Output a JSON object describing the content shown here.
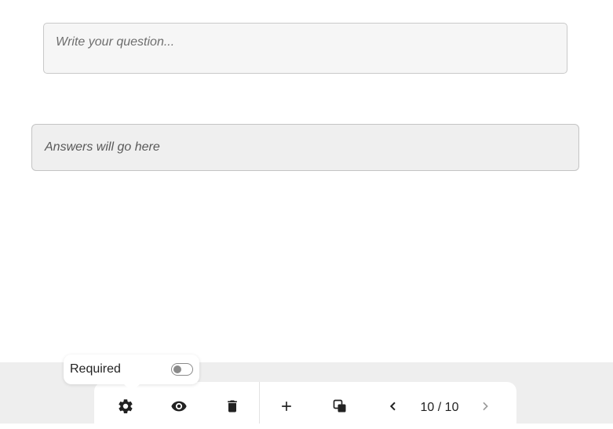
{
  "question": {
    "placeholder": "Write your question...",
    "value": ""
  },
  "answers": {
    "placeholder": "Answers will go here"
  },
  "required_popover": {
    "label": "Required",
    "enabled": false
  },
  "toolbar": {
    "icons": {
      "settings": "gear-icon",
      "preview": "eye-icon",
      "delete": "trash-icon",
      "add": "plus-icon",
      "duplicate": "duplicate-icon",
      "prev": "chevron-left-icon",
      "next": "chevron-right-icon"
    },
    "page_indicator": "10 / 10",
    "next_enabled": false
  },
  "colors": {
    "canvas": "#ffffff",
    "background": "#eeeeee",
    "input_fill": "#f6f6f6",
    "answers_fill": "#efefef",
    "icon": "#222222",
    "icon_disabled": "#9a9a9a"
  }
}
